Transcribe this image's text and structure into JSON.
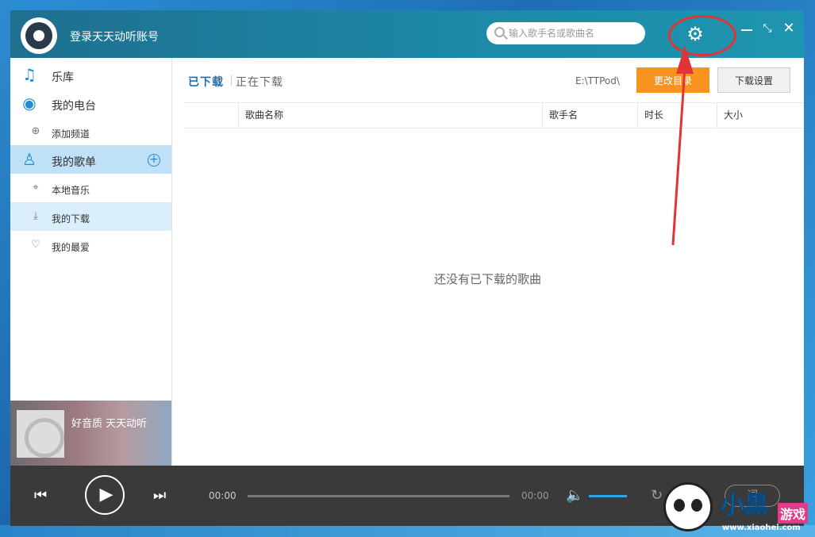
{
  "titlebar": {
    "login_text": "登录天天动听账号",
    "search_placeholder": "输入歌手名或歌曲名",
    "settings_icon": "gear-icon",
    "window_controls": [
      "minimize-icon",
      "mini-mode-icon",
      "close-icon"
    ]
  },
  "sidebar": {
    "library": "乐库",
    "radio": "我的电台",
    "add_channel": "添加频道",
    "my_playlists": "我的歌单",
    "local_music": "本地音乐",
    "my_downloads": "我的下载",
    "my_favorites": "我的最爱",
    "promo_text": "好音质 天天动听"
  },
  "main": {
    "tab_downloaded": "已下载",
    "tab_downloading": "正在下载",
    "download_path": "E:\\TTPod\\",
    "change_dir_button": "更改目录",
    "download_settings_button": "下载设置",
    "columns": [
      "歌曲名称",
      "歌手名",
      "时长",
      "大小"
    ],
    "empty_message": "还没有已下载的歌曲"
  },
  "player": {
    "current_time": "00:00",
    "total_time": "00:00",
    "progress": 0,
    "volume": 1.0,
    "lyric_label": "词"
  },
  "watermark": {
    "brand": "小黑",
    "brand_sub": "游戏",
    "site": "www.xiaohei.com"
  },
  "colors": {
    "accent_blue": "#1e8cd8",
    "orange_button": "#f7931e",
    "annotation_red": "#e23434",
    "titlebar": "#1c8aa8"
  }
}
